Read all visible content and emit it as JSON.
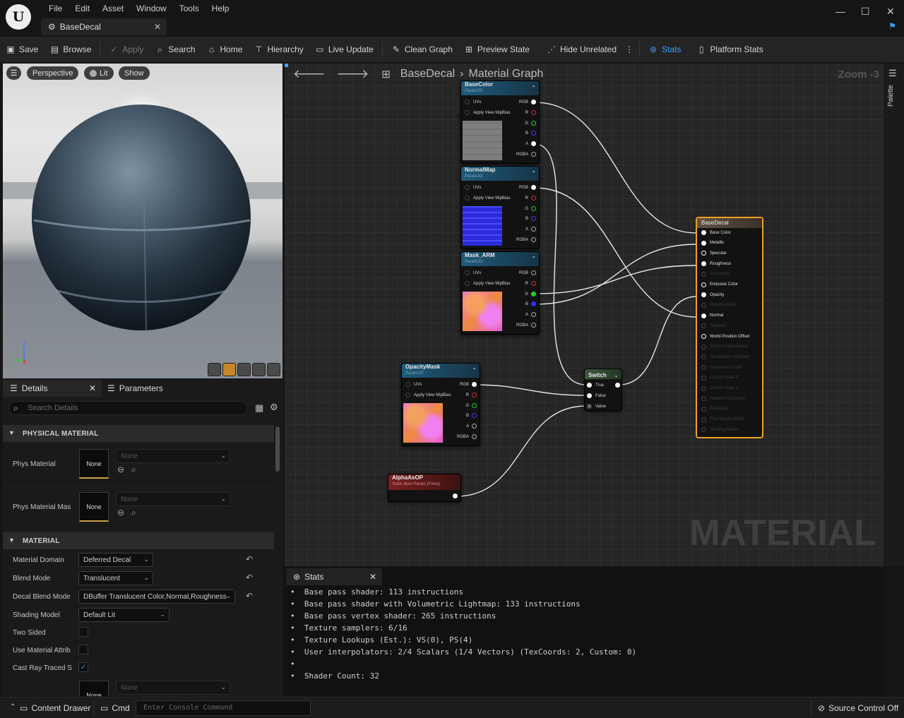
{
  "menu": [
    "File",
    "Edit",
    "Asset",
    "Window",
    "Tools",
    "Help"
  ],
  "doc_tab": {
    "title": "BaseDecal"
  },
  "toolbar": {
    "save": "Save",
    "browse": "Browse",
    "apply": "Apply",
    "search": "Search",
    "home": "Home",
    "hierarchy": "Hierarchy",
    "live_update": "Live Update",
    "clean_graph": "Clean Graph",
    "preview_state": "Preview State",
    "hide_unrelated": "Hide Unrelated",
    "stats": "Stats",
    "platform_stats": "Platform Stats"
  },
  "viewport": {
    "perspective": "Perspective",
    "lit": "Lit",
    "show": "Show",
    "axis_z": "Z",
    "axis_x": "X"
  },
  "details": {
    "tab_details": "Details",
    "tab_parameters": "Parameters",
    "search_placeholder": "Search Details",
    "sections": {
      "physical_material": "PHYSICAL MATERIAL",
      "material": "MATERIAL"
    },
    "phys_material": {
      "label": "Phys Material",
      "thumb": "None",
      "value": "None"
    },
    "phys_material_mask": {
      "label": "Phys Material Mas",
      "thumb": "None",
      "value": "None"
    },
    "material_domain": {
      "label": "Material Domain",
      "value": "Deferred Decal"
    },
    "blend_mode": {
      "label": "Blend Mode",
      "value": "Translucent"
    },
    "decal_blend_mode": {
      "label": "Decal Blend Mode",
      "value": "DBuffer Translucent Color,Normal,Roughness"
    },
    "shading_model": {
      "label": "Shading Model",
      "value": "Default Lit"
    },
    "two_sided": {
      "label": "Two Sided",
      "checked": false
    },
    "use_material_attributes": {
      "label": "Use Material Attrib",
      "checked": false
    },
    "cast_ray_traced": {
      "label": "Cast Ray Traced S",
      "checked": true
    },
    "bottom_thumb": "None",
    "bottom_value": "None"
  },
  "graph": {
    "breadcrumb_root": "BaseDecal",
    "breadcrumb_leaf": "Material Graph",
    "zoom": "Zoom -3",
    "watermark": "MATERIAL",
    "palette": "Palette",
    "tex_nodes": [
      {
        "title": "BaseColor",
        "type": "Param2D"
      },
      {
        "title": "NormalMap",
        "type": "Param2D"
      },
      {
        "title": "Mask_ARM",
        "type": "Param2D"
      },
      {
        "title": "OpacityMask",
        "type": "Param2D"
      }
    ],
    "tex_in_pins": [
      "UVs",
      "Apply View MipBias"
    ],
    "tex_out_pins": [
      "RGB",
      "R",
      "G",
      "B",
      "A",
      "RGBA"
    ],
    "bool_node": {
      "title": "AlphaAsOP",
      "sub": "Static Bool Param (False)"
    },
    "switch_node": {
      "title": "Switch",
      "pins": [
        "True",
        "False",
        "Value"
      ]
    },
    "output_node": {
      "title": "BaseDecal",
      "active": [
        "Base Color",
        "Metallic",
        "Specular",
        "Roughness",
        "Emissive Color",
        "Opacity",
        "Normal",
        "World Position Offset"
      ],
      "pins": [
        "Base Color",
        "Metallic",
        "Specular",
        "Roughness",
        "Anisotropy",
        "Emissive Color",
        "Opacity",
        "Opacity Mask",
        "Normal",
        "Tangent",
        "World Position Offset",
        "World Displacement",
        "Tessellation Multiplier",
        "Subsurface Color",
        "Custom Data 0",
        "Custom Data 1",
        "Ambient Occlusion",
        "Refraction",
        "Pixel Depth Offset",
        "Shading Model"
      ]
    }
  },
  "stats": {
    "tab": "Stats",
    "lines": [
      "Base pass shader: 113 instructions",
      "Base pass shader with Volumetric Lightmap: 133 instructions",
      "Base pass vertex shader: 265 instructions",
      "Texture samplers: 6/16",
      "Texture Lookups (Est.): VS(0), PS(4)",
      "User interpolators: 2/4 Scalars (1/4 Vectors) (TexCoords: 2, Custom: 0)",
      "",
      "Shader Count: 32"
    ]
  },
  "statusbar": {
    "content_drawer": "Content Drawer",
    "cmd": "Cmd",
    "console_placeholder": "Enter Console Command",
    "source_control": "Source Control Off"
  }
}
